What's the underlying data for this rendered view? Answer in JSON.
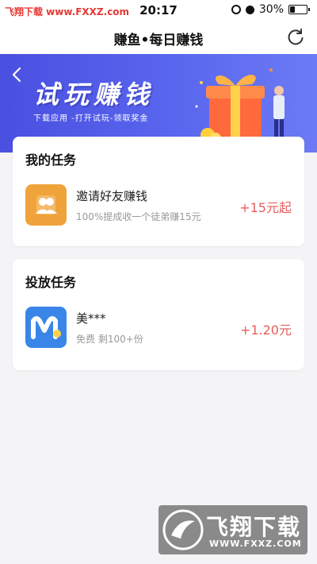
{
  "status_bar": {
    "watermark": "飞翔下载 www.FXXZ.com",
    "time": "20:17",
    "battery": "30%",
    "battery_level": 0.3
  },
  "nav": {
    "title": "赚鱼•每日赚钱",
    "refresh_icon": "refresh-icon"
  },
  "banner": {
    "title": "试玩赚钱",
    "subtitle": "下载应用 -打开试玩-领取奖金",
    "back_icon": "chevron-left-icon"
  },
  "my_tasks": {
    "title": "我的任务",
    "items": [
      {
        "name": "邀请好友赚钱",
        "desc": "100%提成收一个徒弟赚15元",
        "reward": "+15元起",
        "icon": "invite-friends-icon"
      }
    ]
  },
  "ad_tasks": {
    "title": "投放任务",
    "items": [
      {
        "name": "美***",
        "desc": "免费 剩100+份",
        "reward": "+1.20元",
        "icon": "app-m-icon"
      }
    ]
  },
  "watermark": {
    "text": "飞翔下载",
    "url": "WWW.FXXZ.COM"
  },
  "colors": {
    "banner_start": "#4a4fe0",
    "banner_end": "#6c7bf5",
    "reward": "#e85d5d",
    "invite_icon_bg": "#f0a33a",
    "app_icon_bg": "#3a86e8"
  }
}
